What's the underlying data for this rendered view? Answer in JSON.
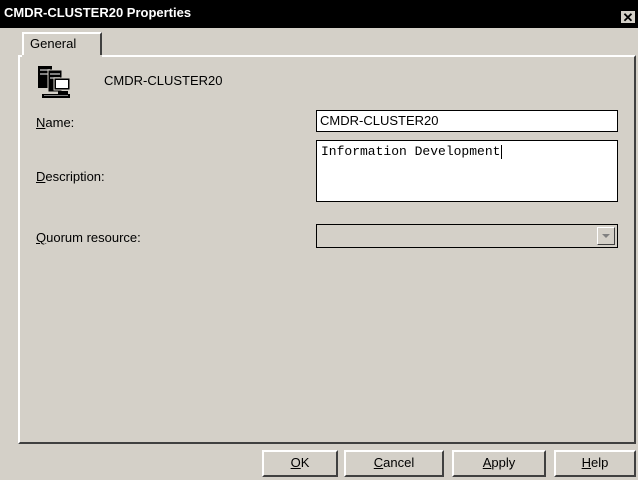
{
  "window": {
    "title": "CMDR-CLUSTER20 Properties",
    "close_glyph": "✕"
  },
  "tabs": [
    {
      "label": "General",
      "active": true
    }
  ],
  "general": {
    "icon": "cluster-icon",
    "cluster_name": "CMDR-CLUSTER20",
    "name": {
      "label_mnemonic": "N",
      "label_rest": "ame:",
      "value": "CMDR-CLUSTER20"
    },
    "description": {
      "label_mnemonic": "D",
      "label_rest": "escription:",
      "value": "Information Development"
    },
    "quorum": {
      "label_mnemonic": "Q",
      "label_rest": "uorum resource:",
      "value": ""
    }
  },
  "buttons": {
    "ok": {
      "mnemonic": "O",
      "rest": "K"
    },
    "cancel": {
      "mnemonic": "C",
      "rest": "ancel"
    },
    "apply": {
      "mnemonic": "A",
      "rest": "pply"
    },
    "help": {
      "mnemonic": "H",
      "rest": "elp"
    }
  },
  "colors": {
    "title_bar": "#000000",
    "dialog_bg": "#d4d0c8",
    "field_bg": "#ffffff"
  }
}
